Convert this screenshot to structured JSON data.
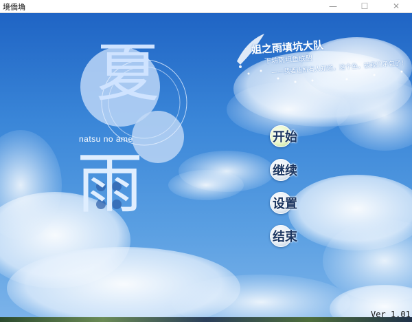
{
  "window": {
    "title": "境僑埆",
    "controls": {
      "minimize": "—",
      "maximize": "☐",
      "close": "✕"
    }
  },
  "logo": {
    "char_top": "夏",
    "char_bottom": "雨",
    "romaji": "natsu no ame"
  },
  "brand": {
    "title": "姐之雨填坑大队",
    "subtitle": "下坊雨坦鱼联盟",
    "slogan": "——我要让所有人知道，这个鱼，被我们承包了！"
  },
  "menu": [
    {
      "label": "开始",
      "active": true
    },
    {
      "label": "继续",
      "active": false
    },
    {
      "label": "设置",
      "active": false
    },
    {
      "label": "结束",
      "active": false
    }
  ],
  "version": "Ver 1.01",
  "colors": {
    "sky_top": "#1f64c4",
    "sky_bottom": "#7db4ea",
    "logo": "#cfe3ff",
    "menu_text": "#1b3560"
  }
}
